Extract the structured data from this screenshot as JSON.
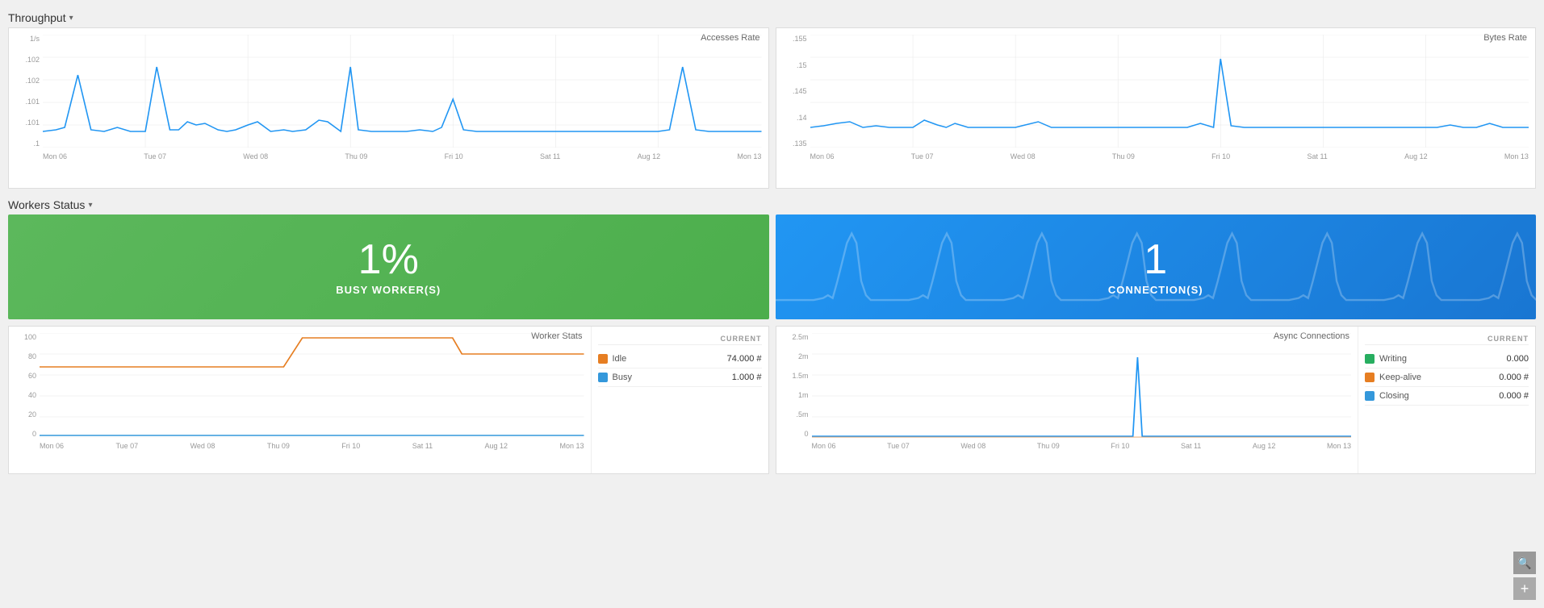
{
  "throughput": {
    "label": "Throughput",
    "chevron": "▾",
    "accesses_chart": {
      "title": "Accesses Rate",
      "y_labels": [
        "1/s",
        ".102",
        ".102",
        ".101",
        ".101",
        ".1"
      ],
      "x_labels": [
        "Mon 06",
        "Tue 07",
        "Wed 08",
        "Thu 09",
        "Fri 10",
        "Sat 11",
        "Aug 12",
        "Mon 13"
      ]
    },
    "bytes_chart": {
      "title": "Bytes Rate",
      "y_labels": [
        ".155",
        ".15",
        ".145",
        ".14",
        ".135"
      ],
      "x_labels": [
        "Mon 06",
        "Tue 07",
        "Wed 08",
        "Thu 09",
        "Fri 10",
        "Sat 11",
        "Aug 12",
        "Mon 13"
      ]
    }
  },
  "workers_status": {
    "label": "Workers Status",
    "chevron": "▾",
    "busy_stat": {
      "number": "1%",
      "label": "BUSY WORKER(S)"
    },
    "connections_stat": {
      "number": "1",
      "label": "CONNECTION(S)"
    },
    "worker_stats": {
      "title": "Worker Stats",
      "header": "CURRENT",
      "rows": [
        {
          "color": "#e67e22",
          "label": "Idle",
          "value": "74.000 #"
        },
        {
          "color": "#3498db",
          "label": "Busy",
          "value": "1.000 #"
        }
      ],
      "y_labels": [
        "100",
        "80",
        "60",
        "40",
        "20",
        "0"
      ],
      "x_labels": [
        "Mon 06",
        "Tue 07",
        "Wed 08",
        "Thu 09",
        "Fri 10",
        "Sat 11",
        "Aug 12",
        "Mon 13"
      ]
    },
    "async_connections": {
      "title": "Async Connections",
      "header": "CURRENT",
      "rows": [
        {
          "color": "#27ae60",
          "label": "Writing",
          "value": "0.000"
        },
        {
          "color": "#e67e22",
          "label": "Keep-alive",
          "value": "0.000 #"
        },
        {
          "color": "#3498db",
          "label": "Closing",
          "value": "0.000 #"
        }
      ],
      "y_labels": [
        "2.5m",
        "2m",
        "1.5m",
        "1m",
        ".5m",
        "0"
      ],
      "x_labels": [
        "Mon 06",
        "Tue 07",
        "Wed 08",
        "Thu 09",
        "Fri 10",
        "Sat 11",
        "Aug 12",
        "Mon 13"
      ]
    }
  },
  "toolbar": {
    "search_icon": "🔍",
    "add_icon": "+"
  }
}
